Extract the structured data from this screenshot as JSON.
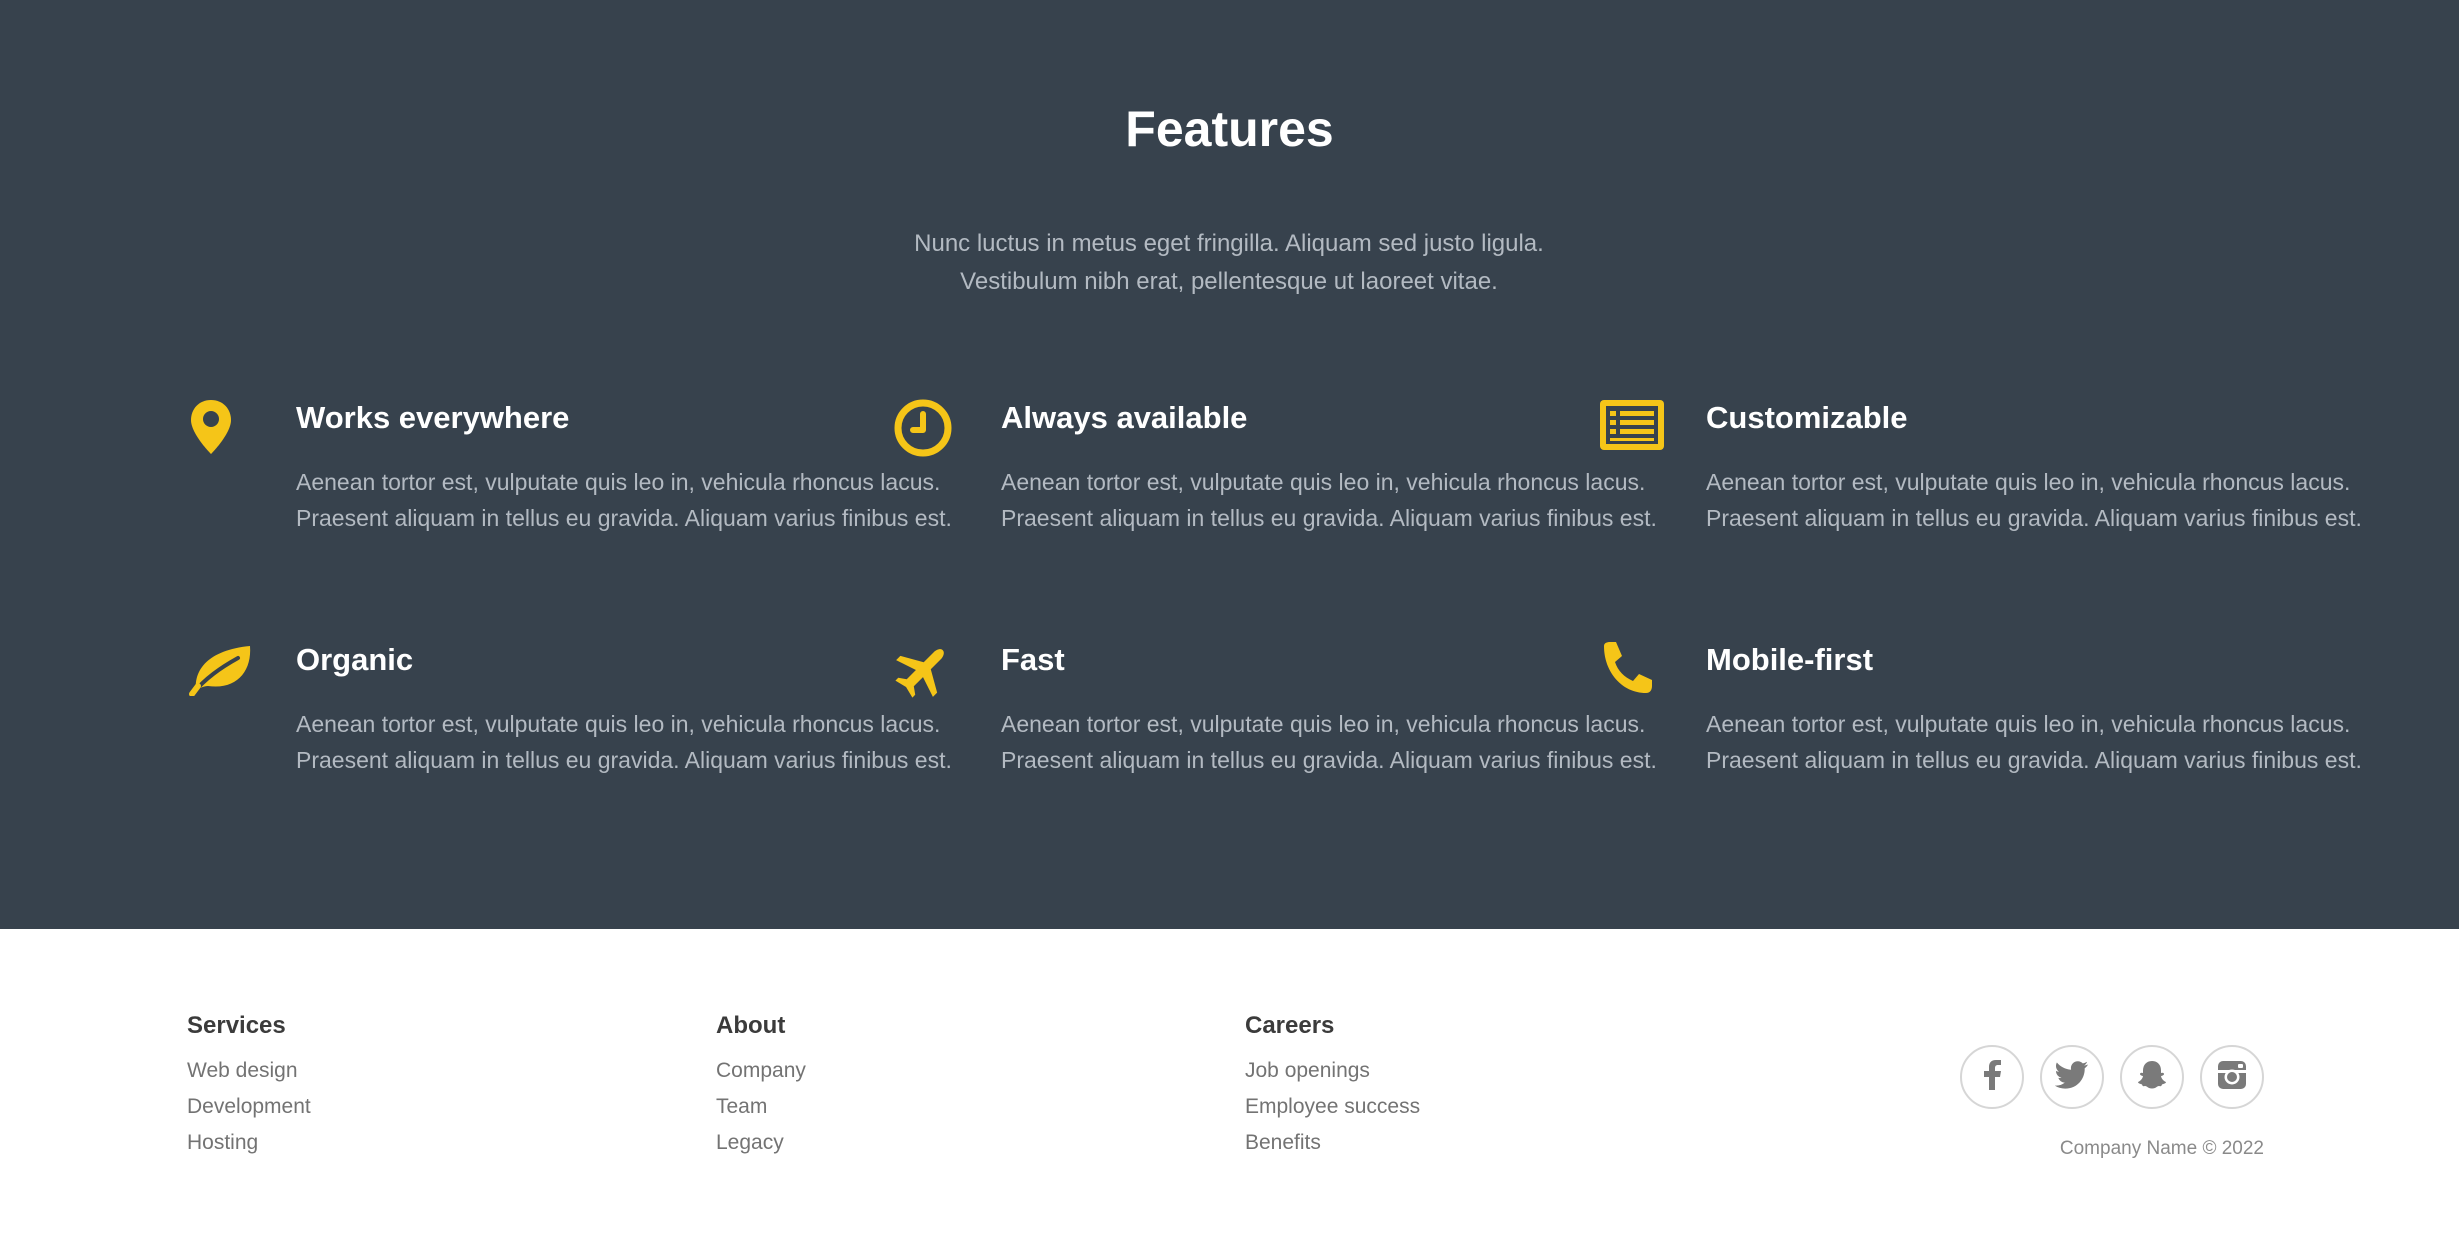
{
  "features_section": {
    "title": "Features",
    "intro_line1": "Nunc luctus in metus eget fringilla. Aliquam sed justo ligula.",
    "intro_line2": "Vestibulum nibh erat, pellentesque ut laoreet vitae.",
    "accent_color": "#f5c518",
    "background_color": "#37424d",
    "items": [
      {
        "icon": "map-pin-icon",
        "title": "Works everywhere",
        "text": "Aenean tortor est, vulputate quis leo in, vehicula rhoncus lacus. Praesent aliquam in tellus eu gravida. Aliquam varius finibus est."
      },
      {
        "icon": "clock-icon",
        "title": "Always available",
        "text": "Aenean tortor est, vulputate quis leo in, vehicula rhoncus lacus. Praesent aliquam in tellus eu gravida. Aliquam varius finibus est."
      },
      {
        "icon": "list-icon",
        "title": "Customizable",
        "text": "Aenean tortor est, vulputate quis leo in, vehicula rhoncus lacus. Praesent aliquam in tellus eu gravida. Aliquam varius finibus est."
      },
      {
        "icon": "leaf-icon",
        "title": "Organic",
        "text": "Aenean tortor est, vulputate quis leo in, vehicula rhoncus lacus. Praesent aliquam in tellus eu gravida. Aliquam varius finibus est."
      },
      {
        "icon": "airplane-icon",
        "title": "Fast",
        "text": "Aenean tortor est, vulputate quis leo in, vehicula rhoncus lacus. Praesent aliquam in tellus eu gravida. Aliquam varius finibus est."
      },
      {
        "icon": "phone-icon",
        "title": "Mobile-first",
        "text": "Aenean tortor est, vulputate quis leo in, vehicula rhoncus lacus. Praesent aliquam in tellus eu gravida. Aliquam varius finibus est."
      }
    ]
  },
  "footer": {
    "columns": [
      {
        "heading": "Services",
        "links": [
          "Web design",
          "Development",
          "Hosting"
        ]
      },
      {
        "heading": "About",
        "links": [
          "Company",
          "Team",
          "Legacy"
        ]
      },
      {
        "heading": "Careers",
        "links": [
          "Job openings",
          "Employee success",
          "Benefits"
        ]
      }
    ],
    "social": [
      "facebook-icon",
      "twitter-icon",
      "snapchat-icon",
      "instagram-icon"
    ],
    "copyright": "Company Name © 2022"
  }
}
